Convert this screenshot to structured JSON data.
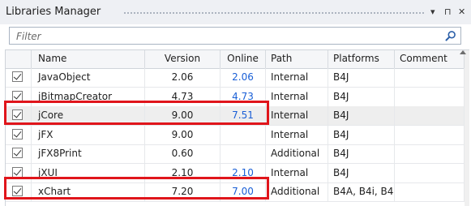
{
  "panel": {
    "title": "Libraries Manager",
    "buttons": {
      "dropdown": "▾",
      "pin": "⊓",
      "close": "✕"
    }
  },
  "filter": {
    "placeholder": "Filter",
    "value": ""
  },
  "colors": {
    "link": "#1a5fd6",
    "highlight": "#e0151b",
    "selected_row": "#eeeeee"
  },
  "columns": [
    "Name",
    "Version",
    "Online",
    "Path",
    "Platforms",
    "Comment"
  ],
  "rows": [
    {
      "checked": true,
      "name": "JavaObject",
      "version": "2.06",
      "online": "2.06",
      "path": "Internal",
      "platforms": "B4J",
      "comment": ""
    },
    {
      "checked": true,
      "name": "jBitmapCreator",
      "version": "4.73",
      "online": "4.73",
      "path": "Internal",
      "platforms": "B4J",
      "comment": ""
    },
    {
      "checked": true,
      "name": "jCore",
      "version": "9.00",
      "online": "7.51",
      "path": "Internal",
      "platforms": "B4J",
      "comment": ""
    },
    {
      "checked": true,
      "name": "jFX",
      "version": "9.00",
      "online": "",
      "path": "Internal",
      "platforms": "B4J",
      "comment": ""
    },
    {
      "checked": true,
      "name": "jFX8Print",
      "version": "0.60",
      "online": "",
      "path": "Additional",
      "platforms": "B4J",
      "comment": ""
    },
    {
      "checked": true,
      "name": "jXUI",
      "version": "2.10",
      "online": "2.10",
      "path": "Internal",
      "platforms": "B4J",
      "comment": ""
    },
    {
      "checked": true,
      "name": "xChart",
      "version": "7.20",
      "online": "7.00",
      "path": "Additional",
      "platforms": "B4A, B4i, B4",
      "comment": ""
    }
  ]
}
